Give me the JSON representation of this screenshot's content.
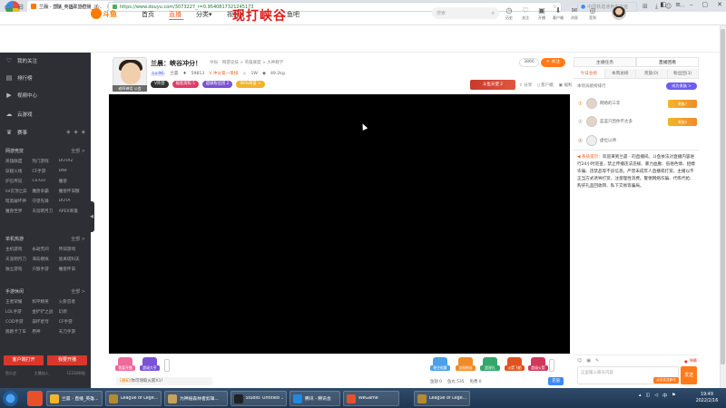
{
  "browser": {
    "logo_label": "云骑手盒",
    "tab_title": "兰晨 - 直播_英雄联盟直播_斗...",
    "url": "https://www.douyu.com/3073227_r=0.9540817321245173",
    "search_placeholder": "中国铁建通用电中金"
  },
  "site": {
    "logo_text": "斗鱼",
    "nav": [
      "首页",
      "直播",
      "分类",
      "视频",
      "鱼吧"
    ],
    "active_nav": "直播",
    "overlay_banner": "现打峡谷",
    "search_placeholder": "搜索",
    "header_icons": [
      "历史",
      "关注",
      "开播",
      "客户端",
      "消息",
      "签到"
    ]
  },
  "sidebar": {
    "main_items": [
      {
        "icon": "heart-icon",
        "label": "我的关注"
      },
      {
        "icon": "rank-icon",
        "label": "排行榜"
      },
      {
        "icon": "video-icon",
        "label": "视频中心"
      },
      {
        "icon": "cloud-icon",
        "label": "云游戏"
      },
      {
        "icon": "trophy-icon",
        "label": "赛事"
      }
    ],
    "sections": [
      {
        "title": "网游竞技",
        "more": "全部 >",
        "items": [
          "英雄联盟",
          "热门游戏",
          "DOTA2",
          "穿越火线",
          "CF手游",
          "DNF",
          "炉石传说",
          "CS:GO",
          "魔兽",
          "lol云顶之弈",
          "魔兽争霸",
          "魔兽怀旧服",
          "暗黑破坏神",
          "守望先锋",
          "DOTA",
          "魔兽世界",
          "天涯明月刀",
          "APEX英雄"
        ]
      },
      {
        "title": "单机热游",
        "more": "全部 >",
        "items": [
          "主机游戏",
          "永劫无间",
          "怀旧游戏",
          "天涯明月刀",
          "海岛模拟",
          "逃离塔科夫",
          "独立游戏",
          "只狼手游",
          "魔兽怀旧"
        ]
      },
      {
        "title": "手游休闲",
        "more": "全部 >",
        "items": [
          "王者荣耀",
          "和平精英",
          "火影忍者",
          "LOL手游",
          "金铲铲之战",
          "幻想",
          "COD手游",
          "崩坏星穹",
          "CF手游",
          "跑跑卡丁车",
          "原神",
          "天刀手游"
        ]
      }
    ],
    "btn_client": "客户端打开",
    "btn_start": "我要开播",
    "footer": [
      "鱼乐会",
      "主播加入",
      "12318举报"
    ],
    "collapse_icon": "◀"
  },
  "room": {
    "avatar_tag": "老四神话 公会",
    "title": "兰晨：峡谷冲分！",
    "report": "举报",
    "breadcrumb": "网游竞技 > 英雄联盟 > 大神教学",
    "level": "Lv.96",
    "anchor": "兰晨",
    "fans": "59813",
    "rank": "V 冲分第一单排",
    "hot": "1W",
    "viewers": "49.2kg",
    "tags": [
      {
        "label": "V阵营",
        "color": "#333333"
      },
      {
        "label": "福星高照 5",
        "color": "#e03b66"
      },
      {
        "label": "超级粉丝团 2",
        "color": "#7a52d6"
      },
      {
        "label": "98%荣誉 >",
        "color": "#f1b32a"
      }
    ],
    "follow_count": "3866",
    "follow_label": "+ 关注",
    "promo": "斗鱼天使 2",
    "actions": [
      "分享",
      "客户端",
      "福利"
    ]
  },
  "gifts": {
    "left": [
      {
        "label": "我爱开播",
        "color": "#ef6a9a"
      },
      {
        "label": "超级大亨",
        "color": "#7a52d6"
      }
    ],
    "right": [
      {
        "label": "稳住能赢",
        "color": "#4aa1e8"
      },
      {
        "label": "全能粉丝",
        "color": "#f08b2a"
      },
      {
        "label": "超星礼",
        "color": "#33a86b"
      },
      {
        "label": "火箭飞船",
        "color": "#e0531f"
      },
      {
        "label": "超级火箭",
        "color": "#d0385a"
      }
    ],
    "notice_pk": "[通知]",
    "notice_text": "你可领取火箭X1！",
    "wallet": [
      "鱼翅 0",
      "鱼丸 535",
      "免费 0"
    ],
    "recharge": "充值"
  },
  "right_panel": {
    "top_tabs": [
      "主播任务",
      "直播回看"
    ],
    "rank_tabs": [
      "今日总榜",
      "本周总榜",
      "贵族(0)",
      "粉丝团(3)"
    ],
    "rank_title": "本场贡献榜排行",
    "rank_btn": "成为贵族 >",
    "ranks": [
      {
        "crown": "♔",
        "crown_color": "#e0a21a",
        "name": "网络的三年",
        "badge": "贵族7"
      },
      {
        "crown": "♔",
        "crown_color": "#9ea5b2",
        "name": "蓝蓝只因你不太多",
        "badge": "贵族5"
      },
      {
        "crown": "♔",
        "crown_color": "#c47a3e",
        "name": "虚位以待",
        "badge": ""
      }
    ],
    "sys_label": "系统提示：",
    "sys_text": "欢迎来到兰晨 - 的直播间。斗鱼依法对直播内容进行24小时巡查，禁止传播违法违规、暴力血腥、低俗色情、招嫖诈骗、违禁品等不良信息。严禁未成年人直播或打赏。主播以不正当方式诱导打赏，注意理性消费。警惕网络诈骗、代练代抢、购买礼品回收转、私下交易等骗局。",
    "hint": "点击发送即可",
    "input_placeholder": "这里输入聊天内容",
    "send": "发送",
    "tools": [
      "表情",
      "礼物",
      "快捷"
    ],
    "danmu": "弹幕"
  },
  "taskbar": {
    "items": [
      {
        "label": "兰晨 - 直播_英雄...",
        "color": "#f3b52a"
      },
      {
        "label": "League of Lege...",
        "color": "#b58a2e"
      },
      {
        "label": "为神秘森林者剪辑...",
        "color": "#c8a25a"
      },
      {
        "label": "Studio: Untitled ...",
        "color": "#222222"
      },
      {
        "label": "腾讯 - 腾讯会",
        "color": "#1f88e5"
      },
      {
        "label": "WeGame",
        "color": "#e6512c"
      },
      {
        "label": "League of Lege...",
        "color": "#b58a2e"
      }
    ],
    "time": "19:49",
    "date": "2022/2/16"
  }
}
